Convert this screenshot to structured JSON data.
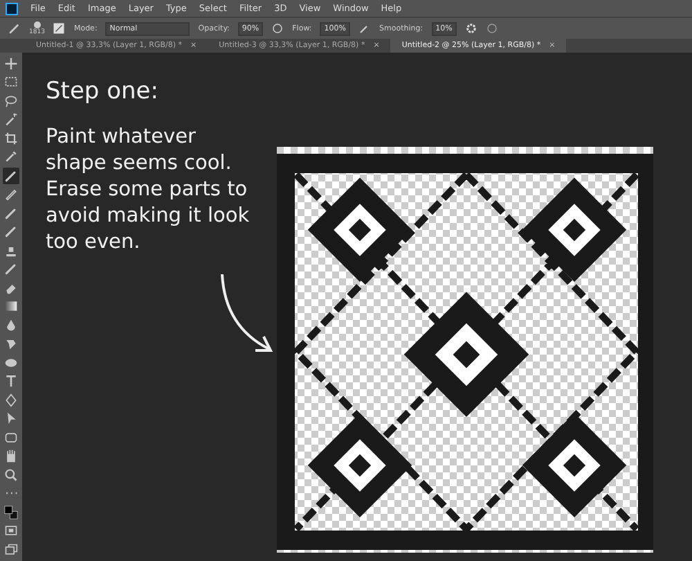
{
  "menu_bar": {
    "items": [
      "File",
      "Edit",
      "Image",
      "Layer",
      "Type",
      "Select",
      "Filter",
      "3D",
      "View",
      "Window",
      "Help"
    ]
  },
  "options_bar": {
    "brush_size": "1813",
    "mode_label": "Mode:",
    "mode": "Normal",
    "opacity_label": "Opacity:",
    "opacity": "90%",
    "flow_label": "Flow:",
    "flow": "100%",
    "smoothing_label": "Smoothing:",
    "smoothing": "10%"
  },
  "tabs": [
    {
      "label": "Untitled-1 @ 33,3% (Layer 1, RGB/8) *",
      "close": "×",
      "selected": false
    },
    {
      "label": "Untitled-3 @ 33,3% (Layer 1, RGB/8) *",
      "close": "×",
      "selected": false
    },
    {
      "label": "Untitled-2 @ 25% (Layer 1, RGB/8) *",
      "close": "×",
      "selected": true
    }
  ],
  "tools": [
    {
      "kind": "move",
      "selected": false
    },
    {
      "kind": "marquee",
      "selected": false
    },
    {
      "kind": "lasso",
      "selected": false
    },
    {
      "kind": "wand",
      "selected": false
    },
    {
      "kind": "crop",
      "selected": false
    },
    {
      "kind": "eyedropper",
      "selected": false
    },
    {
      "kind": "brush",
      "selected": true
    },
    {
      "kind": "pencil",
      "selected": false
    },
    {
      "kind": "brush",
      "selected": false
    },
    {
      "kind": "brush",
      "selected": false
    },
    {
      "kind": "stamp",
      "selected": false
    },
    {
      "kind": "brush",
      "selected": false
    },
    {
      "kind": "eraser",
      "selected": false
    },
    {
      "kind": "gradient",
      "selected": false
    },
    {
      "kind": "drop",
      "selected": false
    },
    {
      "kind": "smudge",
      "selected": false
    },
    {
      "kind": "sponge",
      "selected": false
    },
    {
      "kind": "type",
      "selected": false
    },
    {
      "kind": "pen",
      "selected": false
    },
    {
      "kind": "arrow",
      "selected": false
    },
    {
      "kind": "ellipse",
      "selected": false
    },
    {
      "kind": "hand",
      "selected": false
    },
    {
      "kind": "zoom",
      "selected": false
    },
    {
      "kind": "more",
      "selected": false
    },
    {
      "kind": "colors",
      "selected": false
    },
    {
      "kind": "mask",
      "selected": false
    },
    {
      "kind": "screen",
      "selected": false
    }
  ],
  "tutorial": {
    "heading": "Step one:",
    "body": "Paint whatever\nshape seems cool.\nErase some parts to\navoid making it look\ntoo even."
  }
}
